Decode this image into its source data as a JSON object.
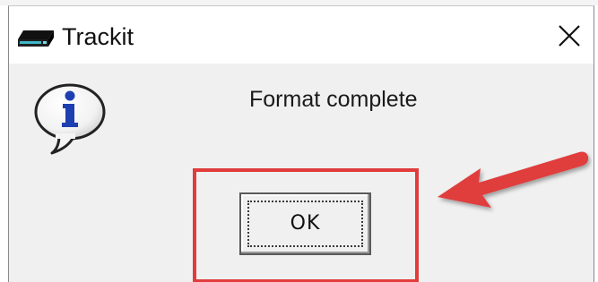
{
  "window": {
    "title": "Trackit",
    "app_icon": "drive-icon",
    "close_icon": "close-icon"
  },
  "dialog": {
    "icon": "info-icon",
    "message": "Format complete",
    "ok_label": "OK"
  },
  "annotation": {
    "highlight_color": "#e03c3c",
    "arrow_color": "#e03c3c"
  }
}
